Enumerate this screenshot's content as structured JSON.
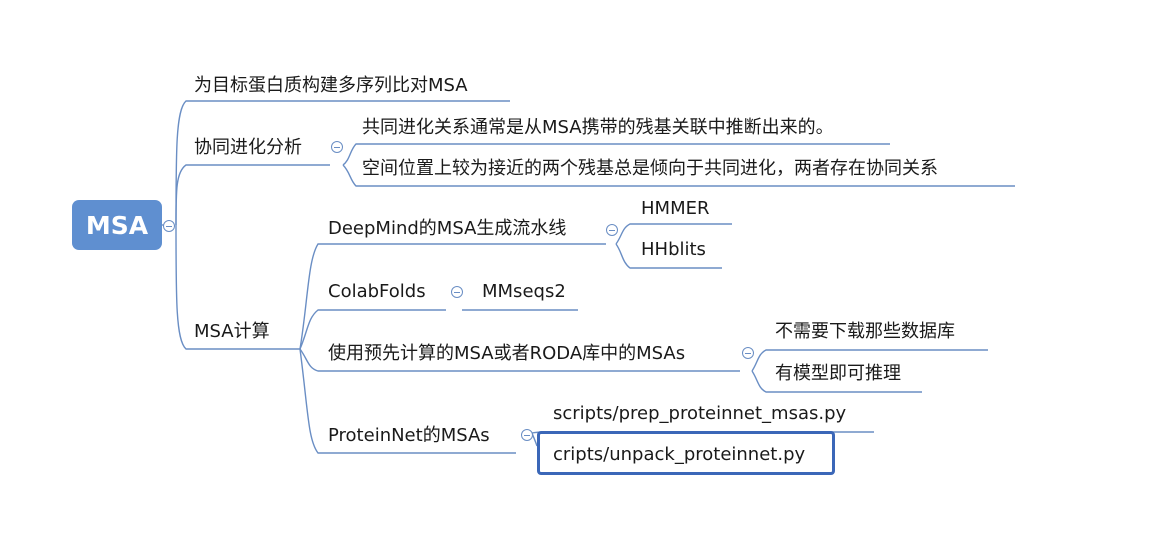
{
  "root": {
    "label": "MSA"
  },
  "branches": [
    {
      "label": "为目标蛋白质构建多序列比对MSA"
    },
    {
      "label": "协同进化分析",
      "children": [
        {
          "label": "共同进化关系通常是从MSA携带的残基关联中推断出来的。"
        },
        {
          "label": "空间位置上较为接近的两个残基总是倾向于共同进化，两者存在协同关系"
        }
      ]
    },
    {
      "label": "MSA计算",
      "children": [
        {
          "label": "DeepMind的MSA生成流水线",
          "children": [
            {
              "label": "HMMER"
            },
            {
              "label": "HHblits"
            }
          ]
        },
        {
          "label": "ColabFolds",
          "children": [
            {
              "label": "MMseqs2"
            }
          ]
        },
        {
          "label": "使用预先计算的MSA或者RODA库中的MSAs",
          "children": [
            {
              "label": "不需要下载那些数据库"
            },
            {
              "label": "有模型即可推理"
            }
          ]
        },
        {
          "label": "ProteinNet的MSAs",
          "children": [
            {
              "label": "scripts/prep_proteinnet_msas.py"
            },
            {
              "label": "cripts/unpack_proteinnet.py"
            }
          ]
        }
      ]
    }
  ],
  "colors": {
    "root_fill": "#5f8fd0",
    "connector": "#6a8ec4",
    "selection": "#3b67b8"
  }
}
